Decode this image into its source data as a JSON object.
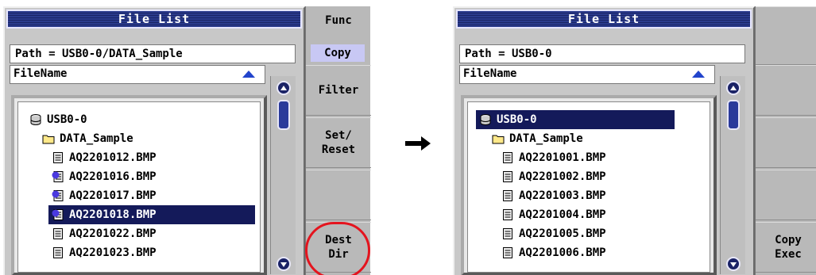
{
  "left": {
    "title": "File List",
    "path": "Path = USB0-0/DATA_Sample",
    "column_header": "FileName",
    "items": [
      {
        "label": "USB0-0",
        "icon": "drive-icon"
      },
      {
        "label": "DATA_Sample",
        "icon": "folder-icon"
      },
      {
        "label": "AQ2201012.BMP",
        "icon": "file-icon"
      },
      {
        "label": "AQ2201016.BMP",
        "icon": "marked-file-icon"
      },
      {
        "label": "AQ2201017.BMP",
        "icon": "marked-file-icon"
      },
      {
        "label": "AQ2201018.BMP",
        "icon": "marked-file-icon",
        "selected": true
      },
      {
        "label": "AQ2201022.BMP",
        "icon": "file-icon"
      },
      {
        "label": "AQ2201023.BMP",
        "icon": "file-icon"
      }
    ],
    "menu": {
      "header": "Func",
      "mode": "Copy",
      "items": [
        "Filter",
        "Set/\nReset",
        "",
        "Dest\nDir"
      ]
    }
  },
  "right": {
    "title": "File List",
    "path": "Path = USB0-0",
    "column_header": "FileName",
    "items": [
      {
        "label": "USB0-0",
        "icon": "drive-icon",
        "selected": true
      },
      {
        "label": "DATA_Sample",
        "icon": "folder-icon"
      },
      {
        "label": "AQ2201001.BMP",
        "icon": "file-icon"
      },
      {
        "label": "AQ2201002.BMP",
        "icon": "file-icon"
      },
      {
        "label": "AQ2201003.BMP",
        "icon": "file-icon"
      },
      {
        "label": "AQ2201004.BMP",
        "icon": "file-icon"
      },
      {
        "label": "AQ2201005.BMP",
        "icon": "file-icon"
      },
      {
        "label": "AQ2201006.BMP",
        "icon": "file-icon"
      }
    ],
    "menu": {
      "items": [
        "",
        "",
        "",
        "",
        "Copy\nExec"
      ]
    }
  },
  "colors": {
    "title_bar": "#1a2566",
    "selection": "#141a5a",
    "scroll": "#1a2266",
    "highlight_ring": "#e4141e",
    "copy_badge": "#c8c8f4"
  }
}
